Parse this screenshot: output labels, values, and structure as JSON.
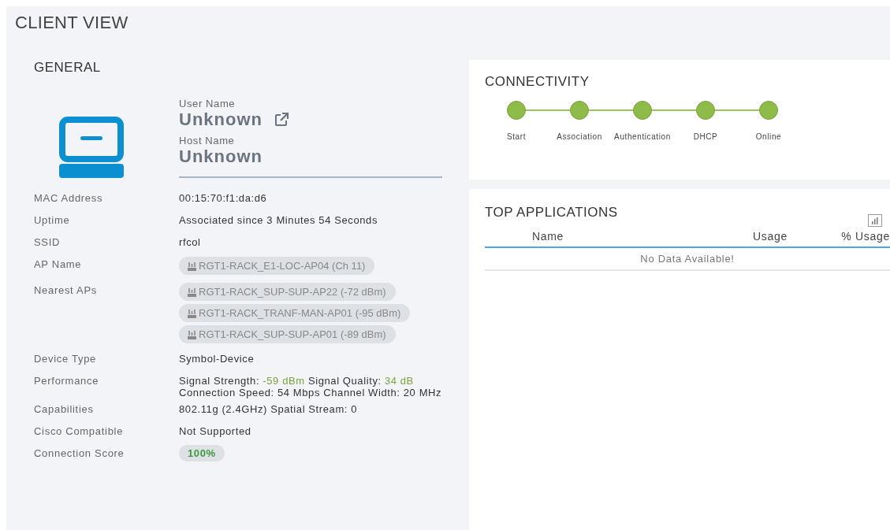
{
  "page_title": "CLIENT VIEW",
  "general": {
    "title": "GENERAL",
    "user_name": {
      "label": "User Name",
      "value": "Unknown"
    },
    "host_name": {
      "label": "Host Name",
      "value": "Unknown"
    },
    "fields": [
      {
        "kind": "text",
        "label": "MAC Address",
        "value": "00:15:70:f1:da:d6"
      },
      {
        "kind": "text",
        "label": "Uptime",
        "value": "Associated since 3 Minutes 54 Seconds"
      },
      {
        "kind": "text",
        "label": "SSID",
        "value": "rfcol"
      },
      {
        "kind": "aps",
        "label": "AP Name",
        "values": [
          "RGT1-RACK_E1-LOC-AP04 (Ch 11)"
        ]
      },
      {
        "kind": "aps",
        "label": "Nearest APs",
        "values": [
          "RGT1-RACK_SUP-SUP-AP22 (-72 dBm)",
          "RGT1-RACK_TRANF-MAN-AP01 (-95 dBm)",
          "RGT1-RACK_SUP-SUP-AP01 (-89 dBm)"
        ]
      },
      {
        "kind": "text",
        "label": "Device Type",
        "value": "Symbol-Device"
      },
      {
        "kind": "parts",
        "label": "Performance",
        "parts": [
          {
            "text": "Signal Strength: ",
            "highlight": false
          },
          {
            "text": "-59 dBm",
            "highlight": true
          },
          {
            "text": " Signal Quality: ",
            "highlight": false
          },
          {
            "text": "34 dB",
            "highlight": true
          },
          {
            "text": " Connection Speed: 54 Mbps Channel Width: 20 MHz",
            "highlight": false
          }
        ]
      },
      {
        "kind": "text",
        "label": "Capabilities",
        "value": "802.11g (2.4GHz) Spatial Stream: 0"
      },
      {
        "kind": "text",
        "label": "Cisco Compatible",
        "value": "Not Supported"
      },
      {
        "kind": "score",
        "label": "Connection Score",
        "value": "100%"
      }
    ]
  },
  "connectivity": {
    "title": "CONNECTIVITY",
    "steps": [
      {
        "label": "Start",
        "done": true
      },
      {
        "label": "Association",
        "done": true
      },
      {
        "label": "Authentication",
        "done": true
      },
      {
        "label": "DHCP",
        "done": true
      },
      {
        "label": "Online",
        "done": true
      }
    ]
  },
  "top_applications": {
    "title": "TOP APPLICATIONS",
    "columns": [
      "Name",
      "Usage",
      "% Usage"
    ],
    "empty_message": "No Data Available!"
  }
}
